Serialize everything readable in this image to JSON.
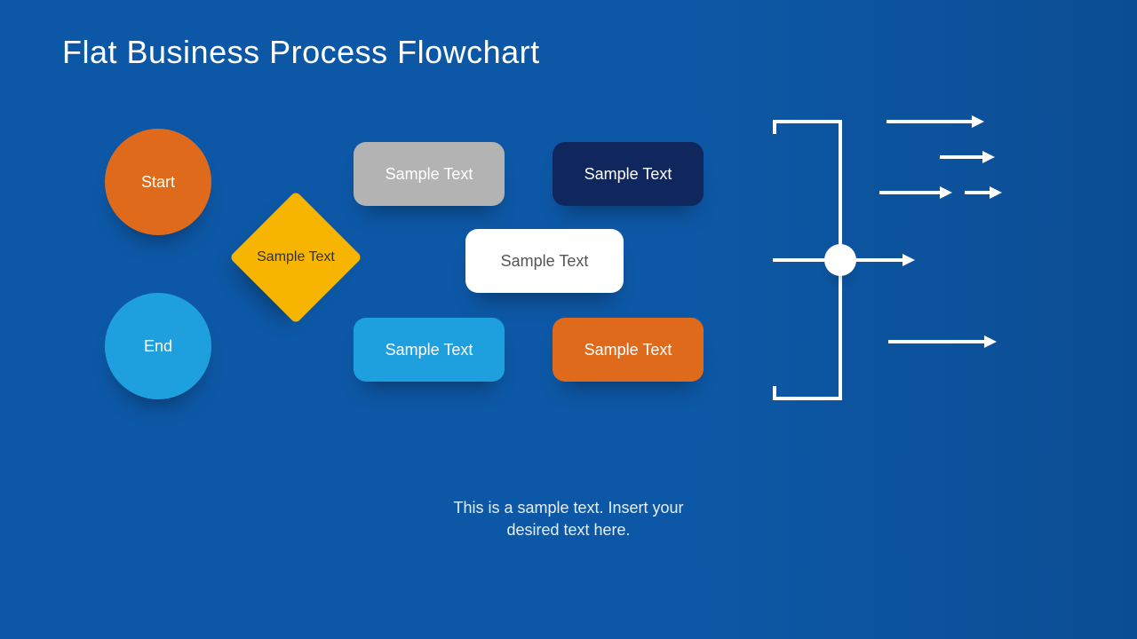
{
  "title": "Flat Business Process Flowchart",
  "shapes": {
    "start": {
      "label": "Start"
    },
    "end": {
      "label": "End"
    },
    "decision": {
      "label": "Sample Text"
    },
    "box_gray": {
      "label": "Sample Text"
    },
    "box_navy": {
      "label": "Sample Text"
    },
    "box_white": {
      "label": "Sample Text"
    },
    "box_blue": {
      "label": "Sample Text"
    },
    "box_orange": {
      "label": "Sample Text"
    }
  },
  "caption_line1": "This is a sample text. Insert your",
  "caption_line2": "desired text here.",
  "colors": {
    "bg_left": "#0d58a6",
    "bg_right": "#0b4d94",
    "orange": "#e06a1b",
    "lightblue": "#1ea0de",
    "yellow": "#f7b500",
    "gray": "#b3b3b3",
    "navy": "#10275e",
    "white": "#ffffff"
  }
}
